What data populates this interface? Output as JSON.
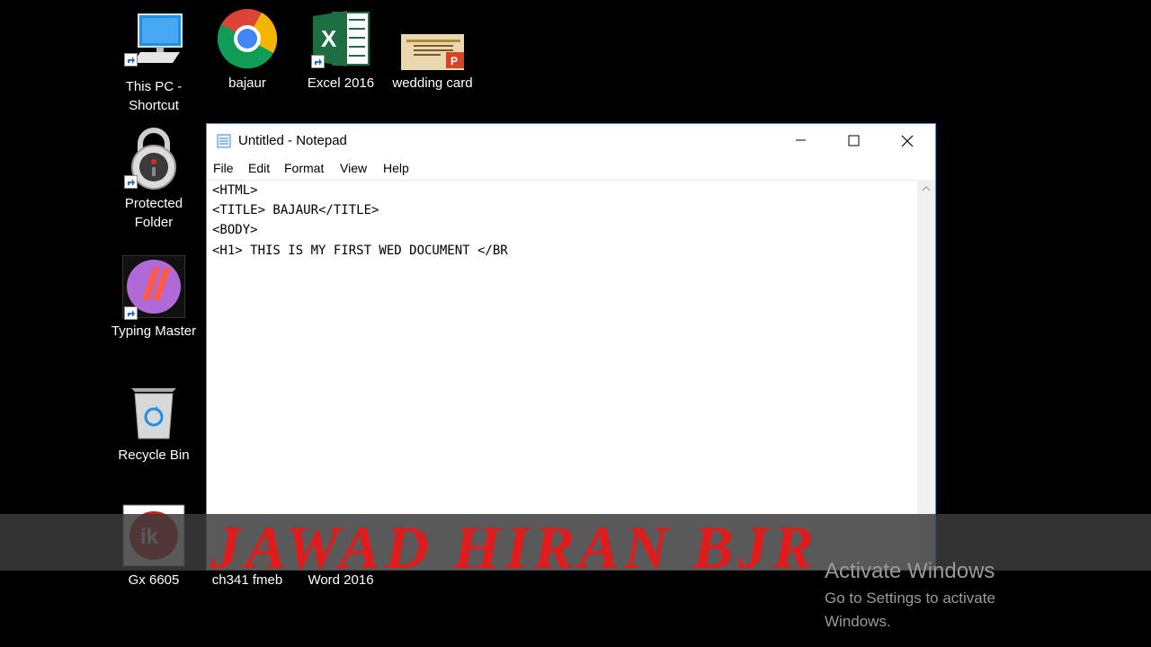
{
  "desktop": {
    "icons": [
      {
        "label": "This PC - Shortcut",
        "icon": "computer-icon"
      },
      {
        "label": "bajaur",
        "icon": "chrome-icon"
      },
      {
        "label": "Excel 2016",
        "icon": "excel-icon"
      },
      {
        "label": "wedding card",
        "icon": "powerpoint-file-icon"
      },
      {
        "label": "Protected Folder",
        "icon": "padlock-icon"
      },
      {
        "label": "Typing Master",
        "icon": "typing-master-icon"
      },
      {
        "label": "Recycle Bin",
        "icon": "recycle-bin-icon"
      },
      {
        "label": "Gx 6605",
        "icon": "ik-logo-icon"
      },
      {
        "label": "ch341 fmeb",
        "icon": "file-icon"
      },
      {
        "label": "Word 2016",
        "icon": "word-icon"
      }
    ]
  },
  "notepad": {
    "title": "Untitled - Notepad",
    "menu": [
      "File",
      "Edit",
      "Format",
      "View",
      "Help"
    ],
    "lines": [
      "<HTML>",
      "<TITLE> BAJAUR</TITLE>",
      "<BODY>",
      "<H1> THIS IS MY FIRST WED DOCUMENT </BR"
    ]
  },
  "overlay": {
    "watermark": "JAWAD HIRAN BJR",
    "activate_title": "Activate Windows",
    "activate_line1": "Go to Settings to activate",
    "activate_line2": "Windows."
  },
  "colors": {
    "desktop_bg": "#000000",
    "watermark": "#e01b1b",
    "window_border": "#5a8fd0"
  }
}
